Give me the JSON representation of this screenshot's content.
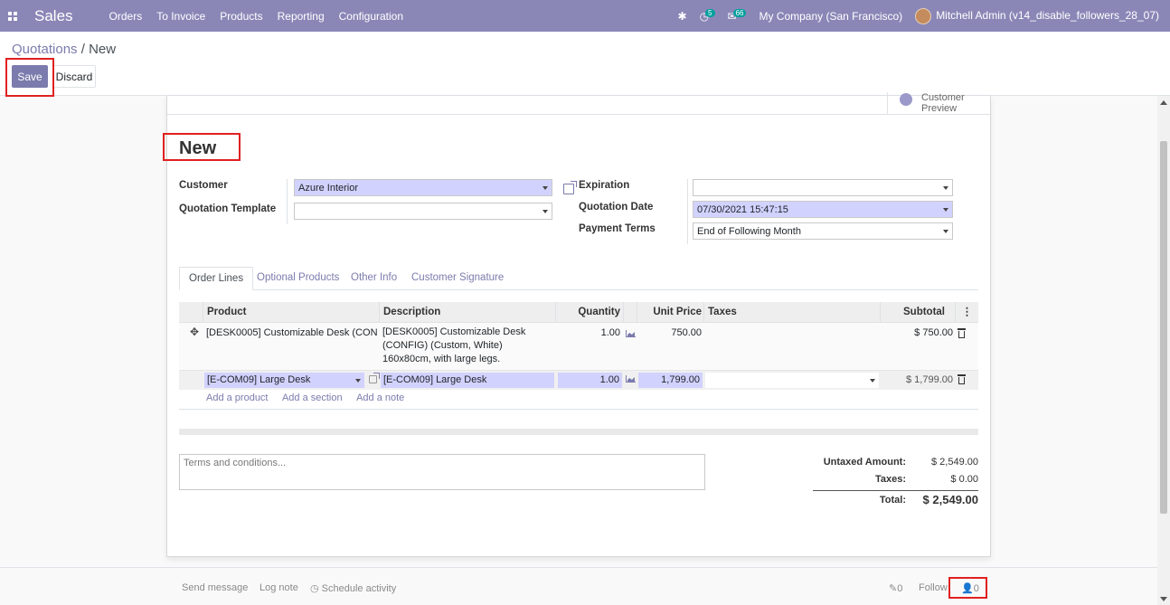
{
  "navbar": {
    "brand": "Sales",
    "menu": [
      "Orders",
      "To Invoice",
      "Products",
      "Reporting",
      "Configuration"
    ],
    "activity_count": "5",
    "message_count": "66",
    "company": "My Company (San Francisco)",
    "user": "Mitchell Admin (v14_disable_followers_28_07)"
  },
  "breadcrumb": {
    "parent": "Quotations",
    "separator": "/",
    "current": "New"
  },
  "buttons": {
    "save": "Save",
    "discard": "Discard"
  },
  "smart_button": {
    "line1": "Customer",
    "line2": "Preview"
  },
  "form": {
    "title": "New",
    "customer_label": "Customer",
    "customer_value": "Azure Interior",
    "template_label": "Quotation Template",
    "template_value": "",
    "expiration_label": "Expiration",
    "expiration_value": "",
    "date_label": "Quotation Date",
    "date_value": "07/30/2021 15:47:15",
    "terms_label": "Payment Terms",
    "terms_value": "End of Following Month"
  },
  "tabs": [
    "Order Lines",
    "Optional Products",
    "Other Info",
    "Customer Signature"
  ],
  "table": {
    "headers": {
      "product": "Product",
      "description": "Description",
      "quantity": "Quantity",
      "unit_price": "Unit Price",
      "taxes": "Taxes",
      "subtotal": "Subtotal"
    },
    "rows": [
      {
        "product": "[DESK0005] Customizable Desk (CON…",
        "description": [
          "[DESK0005] Customizable Desk",
          "(CONFIG) (Custom, White)",
          "160x80cm, with large legs."
        ],
        "quantity": "1.00",
        "unit_price": "750.00",
        "taxes": "",
        "subtotal": "$ 750.00"
      },
      {
        "product": "[E-COM09] Large Desk",
        "description": "[E-COM09] Large Desk",
        "quantity": "1.00",
        "unit_price": "1,799.00",
        "taxes": "",
        "subtotal": "$ 1,799.00"
      }
    ],
    "add_links": [
      "Add a product",
      "Add a section",
      "Add a note"
    ]
  },
  "terms_placeholder": "Terms and conditions...",
  "totals": {
    "untaxed_label": "Untaxed Amount:",
    "untaxed_value": "$ 2,549.00",
    "taxes_label": "Taxes:",
    "taxes_value": "$ 0.00",
    "total_label": "Total:",
    "total_value": "$ 2,549.00"
  },
  "chatter": {
    "send_message": "Send message",
    "log_note": "Log note",
    "schedule_activity": "Schedule activity",
    "attachments": "0",
    "follow": "Follow",
    "followers": "0"
  }
}
